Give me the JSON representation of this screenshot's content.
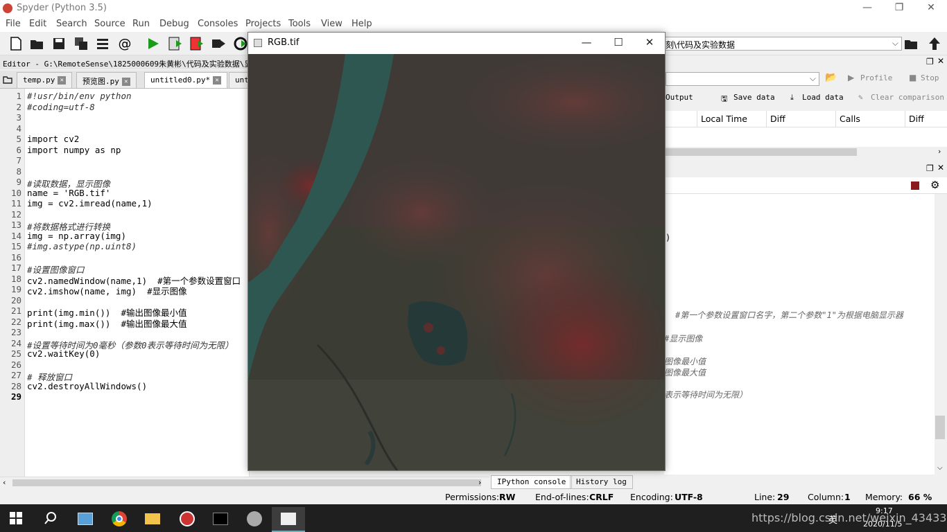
{
  "app": {
    "title": "Spyder (Python 3.5)"
  },
  "menu": [
    "File",
    "Edit",
    "Search",
    "Source",
    "Run",
    "Debug",
    "Consoles",
    "Projects",
    "Tools",
    "View",
    "Help"
  ],
  "toolbar": {
    "path": "刻\\代码及实验数据"
  },
  "editor": {
    "header": "Editor - G:\\RemoteSense\\1825000609朱黄彬\\代码及实验数据\\显示",
    "tabs": [
      {
        "label": "temp.py"
      },
      {
        "label": "预览图.py"
      },
      {
        "label": "untitled0.py*"
      },
      {
        "label": "unt"
      }
    ],
    "lines": [
      {
        "n": "1",
        "code": "#!usr/bin/env python",
        "comment": true
      },
      {
        "n": "2",
        "code": "#coding=utf-8",
        "comment": true
      },
      {
        "n": "3",
        "code": ""
      },
      {
        "n": "4",
        "code": ""
      },
      {
        "n": "5",
        "code": "import cv2"
      },
      {
        "n": "6",
        "code": "import numpy as np"
      },
      {
        "n": "7",
        "code": ""
      },
      {
        "n": "8",
        "code": ""
      },
      {
        "n": "9",
        "code": "#读取数据，显示图像",
        "comment": true
      },
      {
        "n": "10",
        "code": "name = 'RGB.tif'"
      },
      {
        "n": "11",
        "code": "img = cv2.imread(name,1)"
      },
      {
        "n": "12",
        "code": ""
      },
      {
        "n": "13",
        "code": "#将数据格式进行转换",
        "comment": true
      },
      {
        "n": "14",
        "code": "img = np.array(img)"
      },
      {
        "n": "15",
        "code": "#img.astype(np.uint8)",
        "comment": true
      },
      {
        "n": "16",
        "code": ""
      },
      {
        "n": "17",
        "code": "#设置图像窗口",
        "comment": true
      },
      {
        "n": "18",
        "code": "cv2.namedWindow(name,1)  #第一个参数设置窗口"
      },
      {
        "n": "19",
        "code": "cv2.imshow(name, img)  #显示图像"
      },
      {
        "n": "20",
        "code": ""
      },
      {
        "n": "21",
        "code": "print(img.min())  #输出图像最小值"
      },
      {
        "n": "22",
        "code": "print(img.max())  #输出图像最大值"
      },
      {
        "n": "23",
        "code": ""
      },
      {
        "n": "24",
        "code": "#设置等待时间为0毫秒（参数0表示等待时间为无限）",
        "comment": true
      },
      {
        "n": "25",
        "code": "cv2.waitKey(0)"
      },
      {
        "n": "26",
        "code": ""
      },
      {
        "n": "27",
        "code": "# 释放窗口",
        "comment": true
      },
      {
        "n": "28",
        "code": "cv2.destroyAllWindows()"
      },
      {
        "n": "29",
        "code": ""
      }
    ]
  },
  "profiler": {
    "profile_label": "Profile",
    "stop_label": "Stop",
    "output_label": "Output",
    "save_label": "Save data",
    "load_label": "Load data",
    "clear_label": "Clear comparison",
    "columns": [
      "Local Time",
      "Diff",
      "Calls",
      "Diff"
    ]
  },
  "console": {
    "lines": [
      {
        "text": ")"
      },
      {
        "text": "#第一个参数设置窗口名字，第二个参数\"1\"为根据电脑显示器"
      },
      {
        "text": "#显示图像"
      },
      {
        "text": "图像最小值"
      },
      {
        "text": "图像最大值"
      },
      {
        "text": "表示等待时间为无限）"
      }
    ],
    "tabs": [
      "IPython console",
      "History log"
    ]
  },
  "status": {
    "permissions_label": "Permissions:",
    "permissions": "RW",
    "eol_label": "End-of-lines:",
    "eol": "CRLF",
    "encoding_label": "Encoding:",
    "encoding": "UTF-8",
    "line_label": "Line:",
    "line": "29",
    "column_label": "Column:",
    "column": "1",
    "memory_label": "Memory:",
    "memory": "66 %"
  },
  "imagewindow": {
    "title": "RGB.tif"
  },
  "taskbar": {
    "time": "9:17",
    "date": "2020/11/5",
    "ime": "英"
  },
  "watermark": "https://blog.csdn.net/weixin_43433284"
}
